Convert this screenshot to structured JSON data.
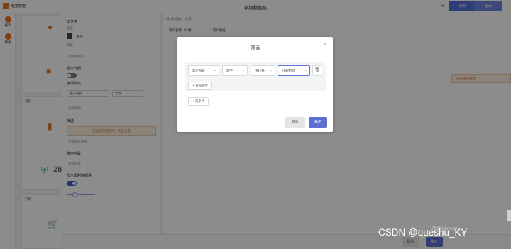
{
  "topbar": {
    "brand": "轻搭数据",
    "title": "表排数据集",
    "save_label": "保存",
    "cancel_label": "退出"
  },
  "leftnav": {
    "items": [
      {
        "label": "展示"
      },
      {
        "label": "模板"
      }
    ]
  },
  "cards": {
    "labels": [
      "客户",
      "查机",
      "订单"
    ],
    "number_partial": "28"
  },
  "config": {
    "workspace_heading": "工作表",
    "workspace_sub": "主表",
    "sheet_item": "客户",
    "sheet_sub": "关联",
    "add_association": "添加关联表",
    "summary_heading": "显示分组",
    "field_list_heading": "字段列表",
    "field_select_1": "客户名称",
    "field_select_2": "计数",
    "add_field": "添加字段",
    "filter_heading": "筛选",
    "filter_warning": "已设置筛选条件，点击查看",
    "add_filter": "添加筛选条件",
    "sort_heading": "排序字段",
    "add_sort": "添加排序",
    "show_limit_heading": "显示限制数据量"
  },
  "preview": {
    "toolbar_text": "共1条记录，1/1页",
    "column_1": "客户名称（计数）",
    "column_2": "客户姓名"
  },
  "rightpanel": {
    "warning": "点击编辑查看"
  },
  "bottombar": {
    "cancel_label": "取消",
    "ok_label": "确定"
  },
  "modal": {
    "title": "筛选",
    "condition": {
      "field": "客户阶段",
      "operator": "等于",
      "value_type": "查找到",
      "value": "时间范围"
    },
    "add_condition": "+ 添加条件",
    "add_group": "+ 或条件",
    "cancel_label": "取消",
    "ok_label": "确定"
  },
  "watermarks": {
    "windows": "激活 Windows",
    "csdn": "CSDN @queshu_KY"
  },
  "colors": {
    "accent": "#5b6fd0",
    "brand_orange": "#e6731f",
    "warning_bg": "#fbeee1"
  }
}
